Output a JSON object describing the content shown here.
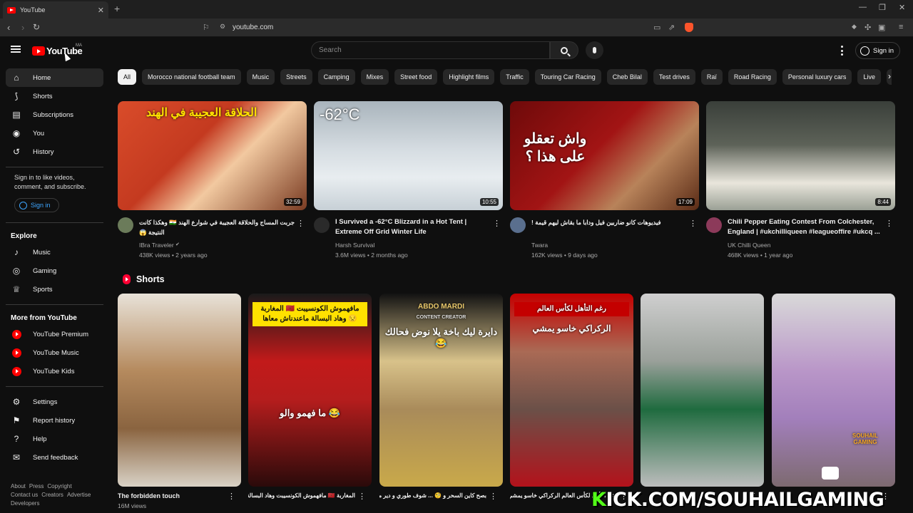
{
  "browser": {
    "tab_title": "YouTube",
    "url": "youtube.com"
  },
  "masthead": {
    "logo_text": "YouTube",
    "country_code": "MA",
    "search_placeholder": "Search",
    "signin_label": "Sign in"
  },
  "sidebar": {
    "main": [
      {
        "label": "Home",
        "icon": "home-icon",
        "glyph": "⌂"
      },
      {
        "label": "Shorts",
        "icon": "shorts-icon",
        "glyph": "⟆"
      },
      {
        "label": "Subscriptions",
        "icon": "subscriptions-icon",
        "glyph": "▤"
      },
      {
        "label": "You",
        "icon": "you-icon",
        "glyph": "◉"
      },
      {
        "label": "History",
        "icon": "history-icon",
        "glyph": "↺"
      }
    ],
    "signin_prompt": "Sign in to like videos, comment, and subscribe.",
    "signin_label": "Sign in",
    "explore_heading": "Explore",
    "explore": [
      {
        "label": "Music",
        "icon": "music-icon",
        "glyph": "♪"
      },
      {
        "label": "Gaming",
        "icon": "gaming-icon",
        "glyph": "◎"
      },
      {
        "label": "Sports",
        "icon": "sports-icon",
        "glyph": "♕"
      }
    ],
    "more_heading": "More from YouTube",
    "more": [
      {
        "label": "YouTube Premium",
        "icon": "youtube-premium-icon"
      },
      {
        "label": "YouTube Music",
        "icon": "youtube-music-icon"
      },
      {
        "label": "YouTube Kids",
        "icon": "youtube-kids-icon"
      }
    ],
    "settings": [
      {
        "label": "Settings",
        "icon": "gear-icon",
        "glyph": "⚙"
      },
      {
        "label": "Report history",
        "icon": "flag-icon",
        "glyph": "⚑"
      },
      {
        "label": "Help",
        "icon": "help-icon",
        "glyph": "?"
      },
      {
        "label": "Send feedback",
        "icon": "feedback-icon",
        "glyph": "✉"
      }
    ],
    "footer_line1": [
      "About",
      "Press",
      "Copyright"
    ],
    "footer_line2": [
      "Contact us",
      "Creators",
      "Advertise"
    ],
    "footer_line3": [
      "Developers"
    ]
  },
  "chips": [
    "All",
    "Morocco national football team",
    "Music",
    "Streets",
    "Camping",
    "Mixes",
    "Street food",
    "Highlight films",
    "Traffic",
    "Touring Car Racing",
    "Cheb Bilal",
    "Test drives",
    "Raï",
    "Road Racing",
    "Personal luxury cars",
    "Live",
    "Off-road"
  ],
  "videos": [
    {
      "title": "جربت المساج والحلاقة العجيبة في شوارع الهند 🇮🇳 وهكذا كانت النتيجة 😱",
      "channel": "IBra Traveler",
      "verified": true,
      "views": "438K views",
      "age": "2 years ago",
      "duration": "32:59",
      "overlay": "الحلاقة العجيبة في الهند"
    },
    {
      "title": "I Survived a -62°C Blizzard in a Hot Tent | Extreme Off Grid Winter Life",
      "channel": "Harsh Survival",
      "views": "3.6M views",
      "age": "2 months ago",
      "duration": "10:55",
      "overlay": "-62°C"
    },
    {
      "title": "فيديوهات كانو ضاربين فيل ودابا ما بقاش ليهم قيمة !",
      "channel": "Twara",
      "views": "162K views",
      "age": "9 days ago",
      "duration": "17:09",
      "overlay": "واش تعقلو على هذا ؟"
    },
    {
      "title": "Chili Pepper Eating Contest From Colchester, England | #ukchilliqueen #leagueoffire #ukcq ...",
      "channel": "UK Chilli Queen",
      "views": "468K views",
      "age": "1 year ago",
      "duration": "8:44"
    }
  ],
  "shorts_heading": "Shorts",
  "shorts": [
    {
      "title": "The forbidden touch",
      "views": "16M views"
    },
    {
      "title": "المغاربة 🇲🇦 مافهموش الكونسيبت وهاد البسالة ماعندناش معاها 🙄",
      "overlay_top": "المغاربة 🇲🇦 مافهموش الكونسيبت وهاد البسالة ماعندناش معاها 😒",
      "overlay_mid": "ما فهمو والو 😂"
    },
    {
      "title": "بصح كاين السحر و 🧐 ... شوف طوري و دير معاك ايوني بكل تواضع نكرو",
      "overlay_top": "ABDO MARDI",
      "overlay_sub": "CONTENT CREATOR",
      "overlay_mid": "دايرة ليك باخة يلا نوض فحالك 😂"
    },
    {
      "title": "رغم التأهل لكأس العالم الركراكي خاسو يمشي",
      "overlay_top": "رغم التأهل لكأس العالم",
      "overlay_mid": "الركراكي خاسو يمشي"
    },
    {
      "title": ""
    },
    {
      "title": ""
    }
  ],
  "watermark": {
    "prefix": "K",
    "text": "ICK.COM/SOUHAILGAMING",
    "brand": "SOUHAIL GAMING"
  }
}
